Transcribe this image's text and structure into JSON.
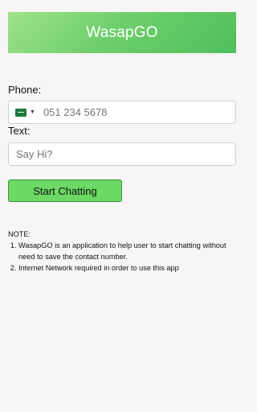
{
  "header": {
    "title": "WasapGO"
  },
  "form": {
    "phone_label": "Phone:",
    "phone_placeholder": "051 234 5678",
    "text_label": "Text:",
    "text_placeholder": "Say Hi?",
    "submit_label": "Start Chatting"
  },
  "note": {
    "heading": "NOTE:",
    "items": [
      "WasapGO is an application to help user to start chatting without need to save the contact number.",
      "Internet Network required in order to use this app"
    ]
  },
  "colors": {
    "header_gradient_start": "#9fe28a",
    "header_gradient_end": "#4fbf5c",
    "button_bg": "#6bd964",
    "button_border": "#3f8f3f",
    "background": "#f7f5f5"
  },
  "icons": {
    "country_flag": "saudi-arabia-flag-icon",
    "dropdown": "caret-down-icon"
  }
}
